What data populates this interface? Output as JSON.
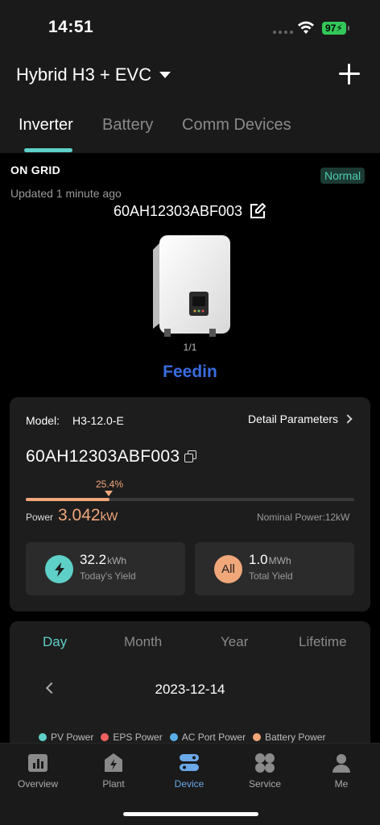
{
  "status_bar": {
    "time": "14:51",
    "battery": "97"
  },
  "header": {
    "station_name": "Hybrid H3 + EVC",
    "tabs": [
      {
        "label": "Inverter",
        "active": true
      },
      {
        "label": "Battery",
        "active": false
      },
      {
        "label": "Comm Devices",
        "active": false
      }
    ]
  },
  "inverter": {
    "grid_status": "ON GRID",
    "status_badge": "Normal",
    "updated": "Updated 1 minute ago",
    "serial": "60AH12303ABF003",
    "pager": "1/1",
    "mode": "Feedin"
  },
  "detail_card": {
    "model_label": "Model:",
    "model_value": "H3-12.0-E",
    "detail_link": "Detail Parameters",
    "serial": "60AH12303ABF003",
    "progress_label": "25.4%",
    "progress_percent": 25.4,
    "power_label": "Power",
    "power_value": "3.042",
    "power_unit": "kW",
    "nominal_power": "Nominal Power:12kW",
    "today_yield": {
      "value": "32.2",
      "unit": "kWh",
      "label": "Today's Yield",
      "icon": "lightning-icon"
    },
    "total_yield": {
      "value": "1.0",
      "unit": "MWh",
      "label": "Total Yield",
      "icon_text": "All"
    }
  },
  "chart_card": {
    "periods": [
      {
        "label": "Day",
        "active": true
      },
      {
        "label": "Month",
        "active": false
      },
      {
        "label": "Year",
        "active": false
      },
      {
        "label": "Lifetime",
        "active": false
      }
    ],
    "date": "2023-12-14",
    "legend": [
      {
        "label": "PV Power",
        "color": "#5fd0c8"
      },
      {
        "label": "EPS Power",
        "color": "#f06060"
      },
      {
        "label": "AC Port Power",
        "color": "#5aaee8"
      },
      {
        "label": "Battery Power",
        "color": "#f0a77a"
      }
    ]
  },
  "colors": {
    "accent": "#5fd0c8",
    "power": "#f0a77a",
    "feedin": "#3a6ce0",
    "nav_active": "#6aa8e8"
  },
  "bottom_nav": [
    {
      "label": "Overview",
      "icon": "chart-icon",
      "active": false
    },
    {
      "label": "Plant",
      "icon": "plant-icon",
      "active": false
    },
    {
      "label": "Device",
      "icon": "device-icon",
      "active": true
    },
    {
      "label": "Service",
      "icon": "grid-icon",
      "active": false
    },
    {
      "label": "Me",
      "icon": "person-icon",
      "active": false
    }
  ]
}
